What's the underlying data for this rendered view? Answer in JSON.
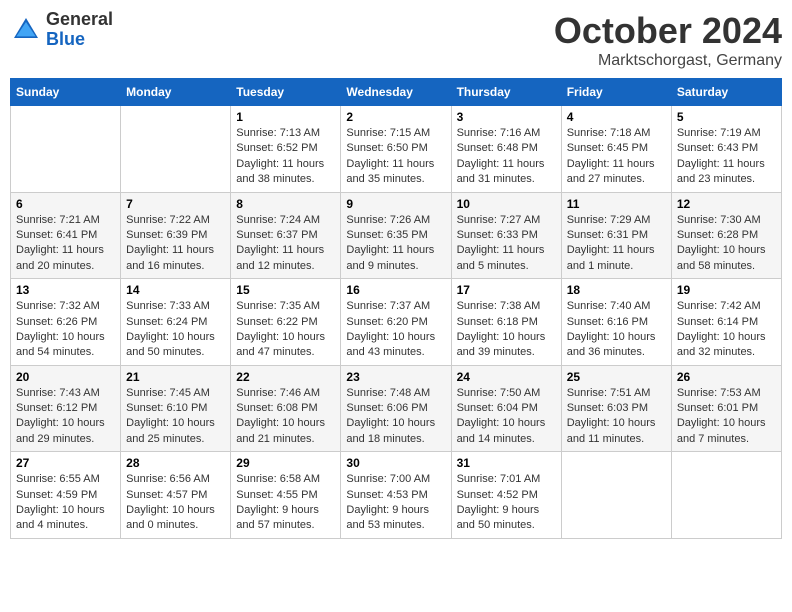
{
  "logo": {
    "general": "General",
    "blue": "Blue"
  },
  "header": {
    "month": "October 2024",
    "location": "Marktschorgast, Germany"
  },
  "weekdays": [
    "Sunday",
    "Monday",
    "Tuesday",
    "Wednesday",
    "Thursday",
    "Friday",
    "Saturday"
  ],
  "weeks": [
    [
      {
        "day": null,
        "info": null
      },
      {
        "day": null,
        "info": null
      },
      {
        "day": "1",
        "info": "Sunrise: 7:13 AM\nSunset: 6:52 PM\nDaylight: 11 hours and 38 minutes."
      },
      {
        "day": "2",
        "info": "Sunrise: 7:15 AM\nSunset: 6:50 PM\nDaylight: 11 hours and 35 minutes."
      },
      {
        "day": "3",
        "info": "Sunrise: 7:16 AM\nSunset: 6:48 PM\nDaylight: 11 hours and 31 minutes."
      },
      {
        "day": "4",
        "info": "Sunrise: 7:18 AM\nSunset: 6:45 PM\nDaylight: 11 hours and 27 minutes."
      },
      {
        "day": "5",
        "info": "Sunrise: 7:19 AM\nSunset: 6:43 PM\nDaylight: 11 hours and 23 minutes."
      }
    ],
    [
      {
        "day": "6",
        "info": "Sunrise: 7:21 AM\nSunset: 6:41 PM\nDaylight: 11 hours and 20 minutes."
      },
      {
        "day": "7",
        "info": "Sunrise: 7:22 AM\nSunset: 6:39 PM\nDaylight: 11 hours and 16 minutes."
      },
      {
        "day": "8",
        "info": "Sunrise: 7:24 AM\nSunset: 6:37 PM\nDaylight: 11 hours and 12 minutes."
      },
      {
        "day": "9",
        "info": "Sunrise: 7:26 AM\nSunset: 6:35 PM\nDaylight: 11 hours and 9 minutes."
      },
      {
        "day": "10",
        "info": "Sunrise: 7:27 AM\nSunset: 6:33 PM\nDaylight: 11 hours and 5 minutes."
      },
      {
        "day": "11",
        "info": "Sunrise: 7:29 AM\nSunset: 6:31 PM\nDaylight: 11 hours and 1 minute."
      },
      {
        "day": "12",
        "info": "Sunrise: 7:30 AM\nSunset: 6:28 PM\nDaylight: 10 hours and 58 minutes."
      }
    ],
    [
      {
        "day": "13",
        "info": "Sunrise: 7:32 AM\nSunset: 6:26 PM\nDaylight: 10 hours and 54 minutes."
      },
      {
        "day": "14",
        "info": "Sunrise: 7:33 AM\nSunset: 6:24 PM\nDaylight: 10 hours and 50 minutes."
      },
      {
        "day": "15",
        "info": "Sunrise: 7:35 AM\nSunset: 6:22 PM\nDaylight: 10 hours and 47 minutes."
      },
      {
        "day": "16",
        "info": "Sunrise: 7:37 AM\nSunset: 6:20 PM\nDaylight: 10 hours and 43 minutes."
      },
      {
        "day": "17",
        "info": "Sunrise: 7:38 AM\nSunset: 6:18 PM\nDaylight: 10 hours and 39 minutes."
      },
      {
        "day": "18",
        "info": "Sunrise: 7:40 AM\nSunset: 6:16 PM\nDaylight: 10 hours and 36 minutes."
      },
      {
        "day": "19",
        "info": "Sunrise: 7:42 AM\nSunset: 6:14 PM\nDaylight: 10 hours and 32 minutes."
      }
    ],
    [
      {
        "day": "20",
        "info": "Sunrise: 7:43 AM\nSunset: 6:12 PM\nDaylight: 10 hours and 29 minutes."
      },
      {
        "day": "21",
        "info": "Sunrise: 7:45 AM\nSunset: 6:10 PM\nDaylight: 10 hours and 25 minutes."
      },
      {
        "day": "22",
        "info": "Sunrise: 7:46 AM\nSunset: 6:08 PM\nDaylight: 10 hours and 21 minutes."
      },
      {
        "day": "23",
        "info": "Sunrise: 7:48 AM\nSunset: 6:06 PM\nDaylight: 10 hours and 18 minutes."
      },
      {
        "day": "24",
        "info": "Sunrise: 7:50 AM\nSunset: 6:04 PM\nDaylight: 10 hours and 14 minutes."
      },
      {
        "day": "25",
        "info": "Sunrise: 7:51 AM\nSunset: 6:03 PM\nDaylight: 10 hours and 11 minutes."
      },
      {
        "day": "26",
        "info": "Sunrise: 7:53 AM\nSunset: 6:01 PM\nDaylight: 10 hours and 7 minutes."
      }
    ],
    [
      {
        "day": "27",
        "info": "Sunrise: 6:55 AM\nSunset: 4:59 PM\nDaylight: 10 hours and 4 minutes."
      },
      {
        "day": "28",
        "info": "Sunrise: 6:56 AM\nSunset: 4:57 PM\nDaylight: 10 hours and 0 minutes."
      },
      {
        "day": "29",
        "info": "Sunrise: 6:58 AM\nSunset: 4:55 PM\nDaylight: 9 hours and 57 minutes."
      },
      {
        "day": "30",
        "info": "Sunrise: 7:00 AM\nSunset: 4:53 PM\nDaylight: 9 hours and 53 minutes."
      },
      {
        "day": "31",
        "info": "Sunrise: 7:01 AM\nSunset: 4:52 PM\nDaylight: 9 hours and 50 minutes."
      },
      {
        "day": null,
        "info": null
      },
      {
        "day": null,
        "info": null
      }
    ]
  ]
}
